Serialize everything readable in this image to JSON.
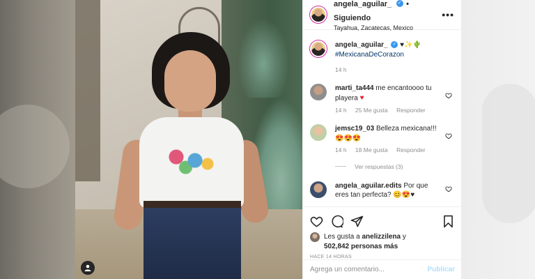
{
  "post": {
    "username": "angela_aguilar_",
    "follow_separator": "•",
    "follow_status": "Siguiendo",
    "location": "Tayahua, Zacatecas, Mexico",
    "more_label": "•••",
    "caption_emojis": "♥✨🌵",
    "hashtag": "#MexicanaDeCorazon",
    "caption_time": "14 h",
    "photo_icon": "user-silhouette-icon"
  },
  "comments": [
    {
      "username": "marti_ta444",
      "text": "me encantoooo tu playera",
      "emoji": "♥",
      "time": "14 h",
      "likes": "25 Me gusta",
      "reply": "Responder"
    },
    {
      "username": "jemsc19_03",
      "text": "Belleza mexicana!!!",
      "emoji": "😍😍😍",
      "time": "14 h",
      "likes": "18 Me gusta",
      "reply": "Responder"
    },
    {
      "username": "angela_aguilar.edits",
      "text": "Por que eres tan perfecta?",
      "emoji": "😊😍♥"
    }
  ],
  "view_replies": "Ver respuestas (3)",
  "likes": {
    "prefix": "Les gusta a",
    "user": "anelizzilena",
    "connector": "y",
    "count": "502,842 personas más"
  },
  "time_ago": "HACE 14 HORAS",
  "comment_box": {
    "placeholder": "Agrega un comentario...",
    "post_label": "Publicar"
  },
  "colors": {
    "link": "#003569",
    "verified": "#3897f0",
    "muted": "#8e8e8e",
    "post_disabled": "#b2dffc"
  }
}
